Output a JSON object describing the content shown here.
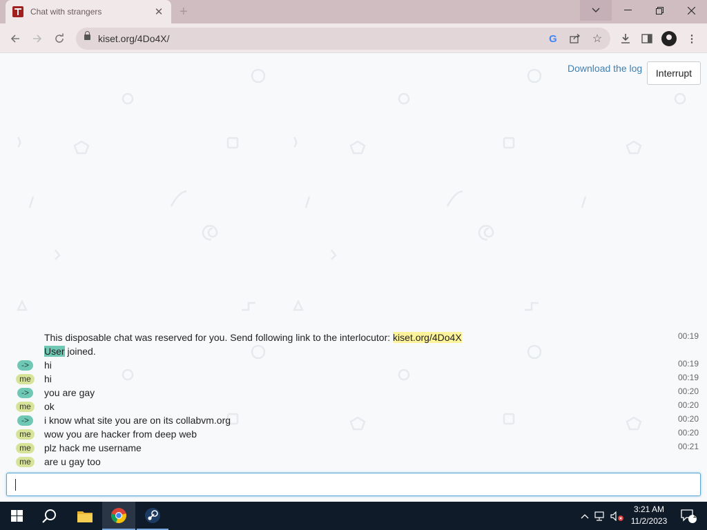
{
  "browser": {
    "tab_title": "Chat with strangers",
    "url": "kiset.org/4Do4X/"
  },
  "page": {
    "download_label": "Download the log",
    "interrupt_label": "Interrupt"
  },
  "chat": {
    "system_intro": "This disposable chat was reserved for you. Send following link to the interlocutor: ",
    "system_link": "kiset.org/4Do4X",
    "system_time": "00:19",
    "joined_user": "User",
    "joined_text": " joined.",
    "messages": [
      {
        "sender": "->",
        "role": "them",
        "text": "hi",
        "time": "00:19"
      },
      {
        "sender": "me",
        "role": "me",
        "text": "hi",
        "time": "00:19"
      },
      {
        "sender": "->",
        "role": "them",
        "text": "you are gay",
        "time": "00:20"
      },
      {
        "sender": "me",
        "role": "me",
        "text": "ok",
        "time": "00:20"
      },
      {
        "sender": "->",
        "role": "them",
        "text": "i know what site you are on its collabvm.org",
        "time": "00:20"
      },
      {
        "sender": "me",
        "role": "me",
        "text": "wow you are hacker from deep web",
        "time": "00:20"
      },
      {
        "sender": "me",
        "role": "me",
        "text": "plz hack me username",
        "time": "00:21"
      },
      {
        "sender": "me",
        "role": "me",
        "text": "are u gay too",
        "time": ""
      }
    ],
    "input_value": ""
  },
  "taskbar": {
    "time": "3:21 AM",
    "date": "11/2/2023",
    "notification_count": "1"
  },
  "colors": {
    "badge_them": "#6fc8b3",
    "badge_me": "#d8e39a",
    "link_highlight": "#fdf39a",
    "accent_link": "#3f7fb0"
  },
  "icons": [
    "tab-favicon-icon",
    "close-icon",
    "new-tab-icon",
    "chevron-down-icon",
    "minimize-icon",
    "maximize-icon",
    "window-close-icon",
    "back-icon",
    "forward-icon",
    "reload-icon",
    "lock-icon",
    "google-icon",
    "share-icon",
    "star-icon",
    "download-icon",
    "side-panel-icon",
    "profile-icon",
    "menu-icon",
    "windows-start-icon",
    "search-icon",
    "file-explorer-icon",
    "chrome-icon",
    "steam-icon",
    "tray-chevron-icon",
    "network-icon",
    "volume-muted-icon",
    "notification-icon"
  ]
}
